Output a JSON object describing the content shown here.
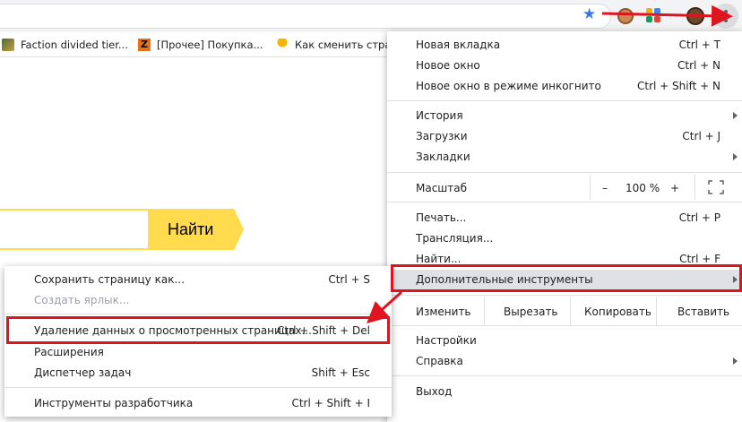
{
  "bookmarks": [
    {
      "label": "Faction divided tier..."
    },
    {
      "label": "[Прочее] Покупка..."
    },
    {
      "label": "Как сменить стран"
    }
  ],
  "search": {
    "button_label": "Найти"
  },
  "menu": {
    "new_tab": {
      "label": "Новая вкладка",
      "shortcut": "Ctrl + T"
    },
    "new_window": {
      "label": "Новое окно",
      "shortcut": "Ctrl + N"
    },
    "incognito": {
      "label": "Новое окно в режиме инкогнито",
      "shortcut": "Ctrl + Shift + N"
    },
    "history": {
      "label": "История"
    },
    "downloads": {
      "label": "Загрузки",
      "shortcut": "Ctrl + J"
    },
    "bookmarks": {
      "label": "Закладки"
    },
    "zoom": {
      "label": "Масштаб",
      "minus": "–",
      "value": "100 %",
      "plus": "+"
    },
    "print": {
      "label": "Печать...",
      "shortcut": "Ctrl + P"
    },
    "cast": {
      "label": "Трансляция..."
    },
    "find": {
      "label": "Найти...",
      "shortcut": "Ctrl + F"
    },
    "more_tools": {
      "label": "Дополнительные инструменты"
    },
    "edit": {
      "label": "Изменить",
      "cut": "Вырезать",
      "copy": "Копировать",
      "paste": "Вставить"
    },
    "settings": {
      "label": "Настройки"
    },
    "help": {
      "label": "Справка"
    },
    "exit": {
      "label": "Выход"
    }
  },
  "submenu": {
    "save_page": {
      "label": "Сохранить страницу как...",
      "shortcut": "Ctrl + S"
    },
    "create_shortcut": {
      "label": "Создать ярлык..."
    },
    "clear_data": {
      "label": "Удаление данных о просмотренных страницах...",
      "shortcut": "Ctrl + Shift + Del"
    },
    "extensions": {
      "label": "Расширения"
    },
    "task_manager": {
      "label": "Диспетчер задач",
      "shortcut": "Shift + Esc"
    },
    "dev_tools": {
      "label": "Инструменты разработчика",
      "shortcut": "Ctrl + Shift + I"
    }
  },
  "colors": {
    "accent_red": "#e0141e",
    "yandex_yellow": "#ffdb4d",
    "highlight": "#dfe1e5"
  }
}
